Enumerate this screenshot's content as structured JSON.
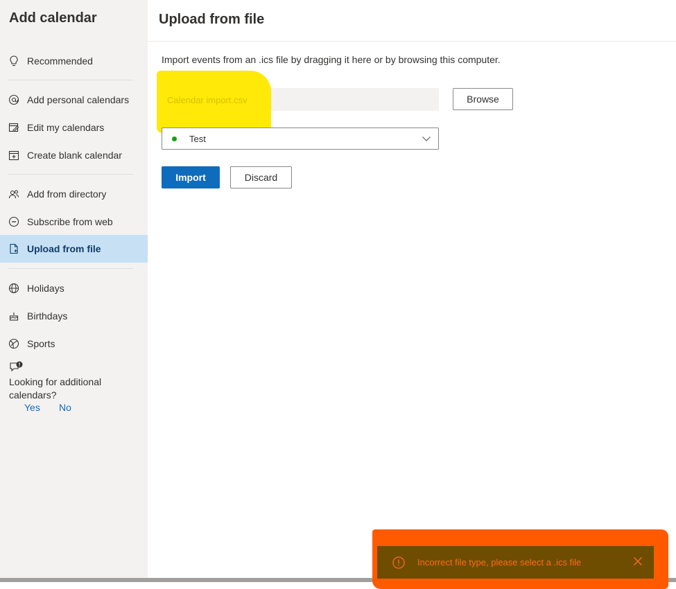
{
  "sidebar": {
    "title": "Add calendar",
    "items": [
      {
        "label": "Recommended",
        "icon": "lightbulb-icon"
      },
      {
        "label": "Add personal calendars",
        "icon": "at-sign-icon"
      },
      {
        "label": "Edit my calendars",
        "icon": "edit-calendar-icon"
      },
      {
        "label": "Create blank calendar",
        "icon": "calendar-add-icon"
      },
      {
        "label": "Add from directory",
        "icon": "people-icon"
      },
      {
        "label": "Subscribe from web",
        "icon": "link-icon"
      },
      {
        "label": "Upload from file",
        "icon": "document-upload-icon"
      },
      {
        "label": "Holidays",
        "icon": "globe-icon"
      },
      {
        "label": "Birthdays",
        "icon": "cake-icon"
      },
      {
        "label": "Sports",
        "icon": "ball-icon"
      }
    ],
    "selected": "Upload from file",
    "feedback": {
      "question": "Looking for additional calendars?",
      "yes": "Yes",
      "no": "No"
    }
  },
  "main": {
    "title": "Upload from file",
    "description": "Import events from an .ics file by dragging it here or by browsing this computer.",
    "file_value": "Calendar import.csv",
    "browse_label": "Browse",
    "calendar_select": {
      "value": "Test",
      "dot_color": "#13a10e"
    },
    "import_label": "Import",
    "discard_label": "Discard"
  },
  "toast": {
    "message": "Incorrect file type, please select a .ics file",
    "type": "error"
  },
  "colors": {
    "accent": "#0f6cbd",
    "selected_bg": "#c7e0f4",
    "highlight_yellow": "#ffe800",
    "highlight_orange": "#ff5a00"
  }
}
